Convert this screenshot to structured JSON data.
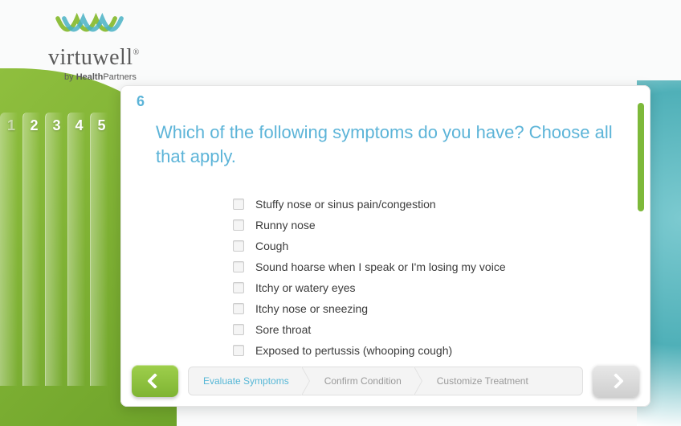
{
  "brand": {
    "name": "virtuwell",
    "byline_prefix": "by ",
    "byline_bold": "Health",
    "byline_rest": "Partners"
  },
  "steps_behind": [
    "1",
    "2",
    "3",
    "4",
    "5"
  ],
  "card": {
    "number": "6",
    "question": "Which of the following symptoms do you have? Choose all that apply.",
    "options": [
      "Stuffy nose or sinus pain/congestion",
      "Runny nose",
      "Cough",
      "Sound hoarse when I speak or I'm losing my voice",
      "Itchy or watery eyes",
      "Itchy nose or sneezing",
      "Sore throat",
      "Exposed to pertussis (whooping cough)"
    ]
  },
  "breadcrumb": {
    "items": [
      "Evaluate Symptoms",
      "Confirm Condition",
      "Customize Treatment"
    ],
    "active_index": 0
  }
}
